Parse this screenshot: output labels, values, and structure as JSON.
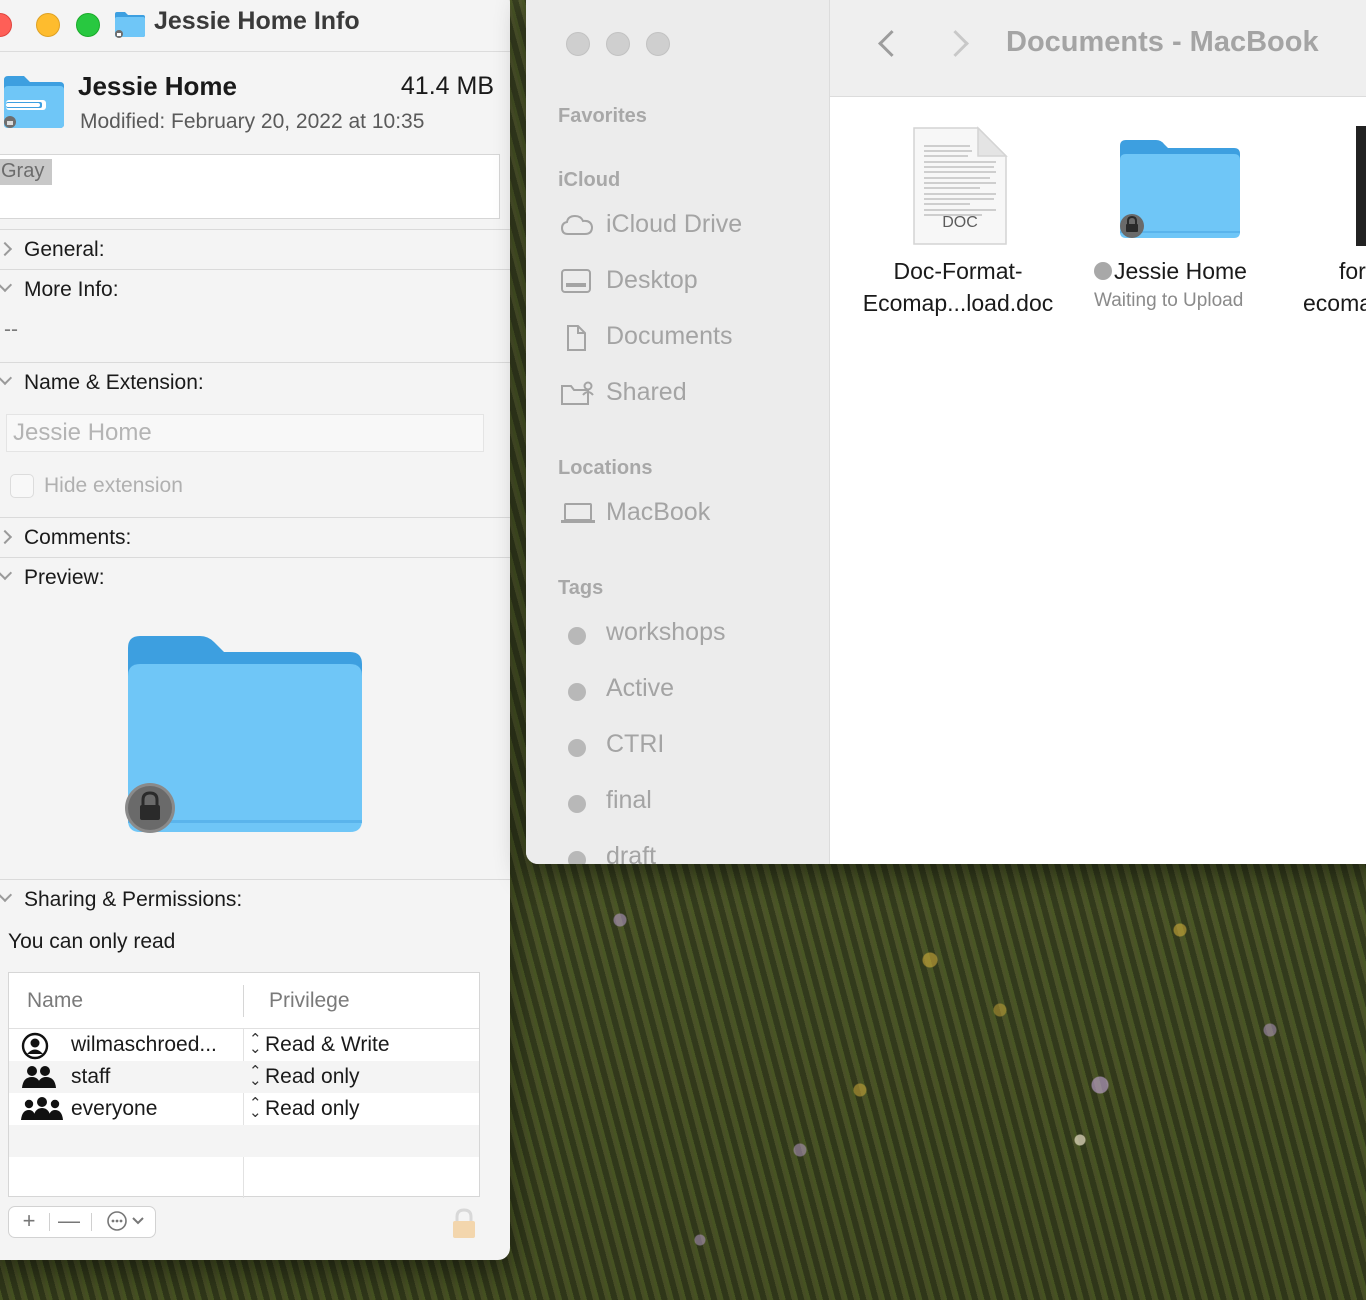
{
  "info_window": {
    "title": "Jessie Home Info",
    "item_name": "Jessie Home",
    "size": "41.4 MB",
    "modified": "Modified: February 20, 2022 at 10:35",
    "tag": "Gray",
    "sections": {
      "general": "General:",
      "more_info": "More Info:",
      "more_info_value": "--",
      "name_extension": "Name & Extension:",
      "comments": "Comments:",
      "preview": "Preview:",
      "sharing": "Sharing & Permissions:"
    },
    "name_field_value": "Jessie Home",
    "hide_extension_label": "Hide extension",
    "hide_extension_checked": false,
    "permission_note": "You can only read",
    "permissions": {
      "col_name": "Name",
      "col_privilege": "Privilege",
      "rows": [
        {
          "name": "wilmaschroed...",
          "privilege": "Read & Write",
          "icon": "single-user-icon"
        },
        {
          "name": "staff",
          "privilege": "Read only",
          "icon": "group-icon"
        },
        {
          "name": "everyone",
          "privilege": "Read only",
          "icon": "everyone-icon"
        }
      ]
    },
    "toolbar": {
      "add": "+",
      "remove": "—"
    }
  },
  "finder": {
    "title": "Documents - MacBook",
    "sidebar": {
      "favorites_heading": "Favorites",
      "icloud_heading": "iCloud",
      "icloud_items": [
        {
          "label": "iCloud Drive",
          "icon": "cloud-icon"
        },
        {
          "label": "Desktop",
          "icon": "desktop-icon"
        },
        {
          "label": "Documents",
          "icon": "document-icon"
        },
        {
          "label": "Shared",
          "icon": "shared-folder-icon"
        }
      ],
      "locations_heading": "Locations",
      "location_items": [
        {
          "label": "MacBook",
          "icon": "laptop-icon"
        }
      ],
      "tags_heading": "Tags",
      "tag_items": [
        {
          "label": "workshops"
        },
        {
          "label": "Active"
        },
        {
          "label": "CTRI"
        },
        {
          "label": "final"
        },
        {
          "label": "draft"
        }
      ]
    },
    "files": [
      {
        "name_line1": "Doc-Format-",
        "name_line2": "Ecomap...load.doc",
        "badge": "DOC"
      },
      {
        "name": "Jessie Home",
        "status": "Waiting to Upload"
      },
      {
        "name_line1": "for",
        "name_line2": "ecoma"
      }
    ]
  },
  "colors": {
    "folder_blue": "#6fc6f7",
    "folder_blue_dark": "#3d9fe0",
    "tag_gray": "#b8b8b8"
  }
}
